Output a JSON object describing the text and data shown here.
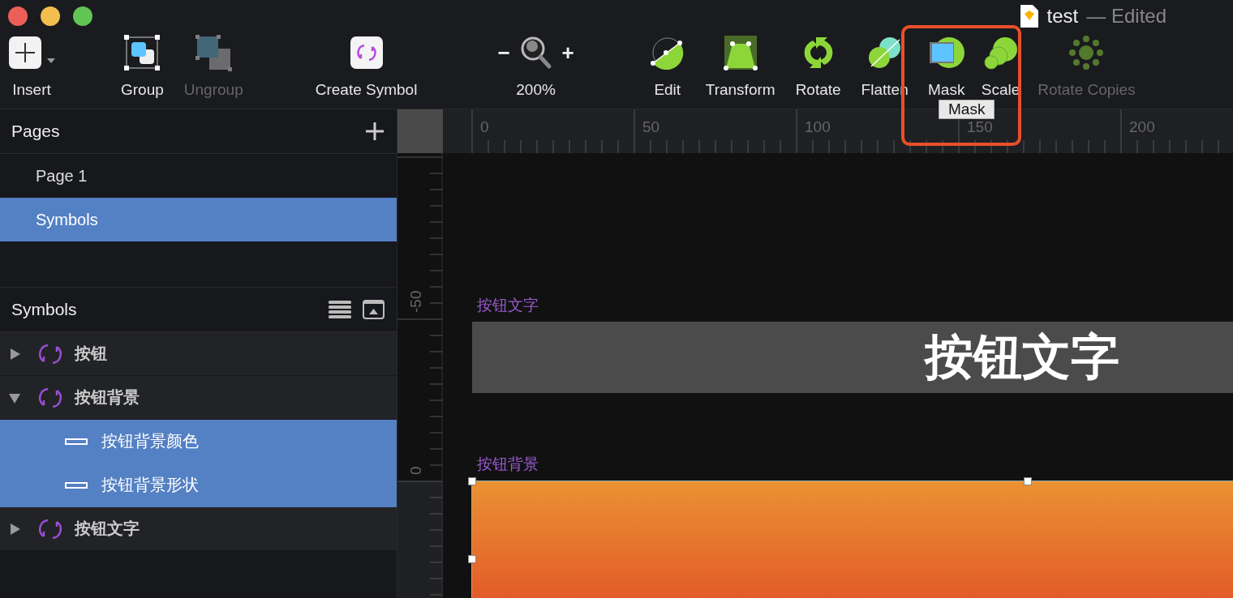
{
  "window": {
    "title": "test",
    "status": "— Edited"
  },
  "toolbar": {
    "items": [
      {
        "kind": "insert",
        "label": "Insert",
        "disabled": false
      },
      {
        "kind": "group",
        "label": "Group",
        "disabled": false
      },
      {
        "kind": "ungroup",
        "label": "Ungroup",
        "disabled": true
      },
      {
        "kind": "symbol",
        "label": "Create Symbol",
        "disabled": false
      },
      {
        "kind": "zoom",
        "label": "200%",
        "minus": "−",
        "plus": "+"
      },
      {
        "kind": "edit",
        "label": "Edit",
        "disabled": false
      },
      {
        "kind": "transform",
        "label": "Transform",
        "disabled": false
      },
      {
        "kind": "rotate",
        "label": "Rotate",
        "disabled": false
      },
      {
        "kind": "flatten",
        "label": "Flatten",
        "disabled": false
      },
      {
        "kind": "mask",
        "label": "Mask",
        "disabled": false
      },
      {
        "kind": "scale",
        "label": "Scale",
        "disabled": false
      },
      {
        "kind": "rotate-copies",
        "label": "Rotate Copies",
        "disabled": true
      }
    ],
    "tooltip": "Mask"
  },
  "pages": {
    "title": "Pages",
    "items": [
      {
        "label": "Page 1",
        "selected": false
      },
      {
        "label": "Symbols",
        "selected": true
      }
    ]
  },
  "symbols": {
    "title": "Symbols",
    "items": [
      {
        "kind": "symbol",
        "label": "按钮",
        "expanded": false,
        "selected": false
      },
      {
        "kind": "symbol",
        "label": "按钮背景",
        "expanded": true,
        "selected": false,
        "children": [
          {
            "kind": "layer",
            "label": "按钮背景颜色",
            "selected": true
          },
          {
            "kind": "layer",
            "label": "按钮背景形状",
            "selected": true
          }
        ]
      },
      {
        "kind": "symbol",
        "label": "按钮文字",
        "expanded": false,
        "selected": false
      }
    ]
  },
  "rulers": {
    "horizontal": [
      "0",
      "50",
      "100",
      "150",
      "200"
    ],
    "vertical": [
      "-50",
      "0"
    ]
  },
  "artboards": [
    {
      "kind": "text",
      "name": "按钮文字",
      "text": "按钮文字"
    },
    {
      "kind": "gradient",
      "name": "按钮背景",
      "selected": true
    }
  ]
}
